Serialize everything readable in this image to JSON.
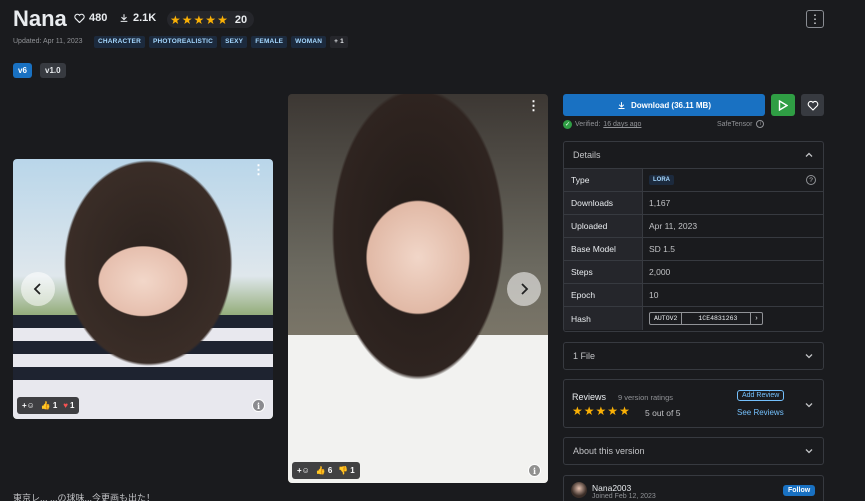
{
  "header": {
    "title": "Nana",
    "likes": "480",
    "downloads": "2.1K",
    "rating_count": "20",
    "updated": "Updated: Apr 11, 2023",
    "tags": [
      "CHARACTER",
      "PHOTOREALISTIC",
      "SEXY",
      "FEMALE",
      "WOMAN"
    ],
    "more_tags": "+ 1"
  },
  "versions": [
    "v6",
    "v1.0"
  ],
  "gallery": {
    "image1": {
      "thumbs_up": "1",
      "hearts": "1"
    },
    "image2": {
      "thumbs_up": "6",
      "thumbs_down": "1"
    }
  },
  "description_preview": "東京レ...  ...の球味...今更画も出た！",
  "sidebar": {
    "download_label": "Download (36.11 MB)",
    "verified_label": "Verified:",
    "verified_when": "16 days ago",
    "safetensor": "SafeTensor",
    "details_title": "Details",
    "details": [
      {
        "label": "Type",
        "value": "LORA"
      },
      {
        "label": "Downloads",
        "value": "1,167"
      },
      {
        "label": "Uploaded",
        "value": "Apr 11, 2023"
      },
      {
        "label": "Base Model",
        "value": "SD 1.5"
      },
      {
        "label": "Steps",
        "value": "2,000"
      },
      {
        "label": "Epoch",
        "value": "10"
      },
      {
        "label": "Hash",
        "value": ""
      }
    ],
    "hash_algo": "AUTOV2",
    "hash_value": "1CE4831263",
    "files_label": "1 File",
    "reviews_label": "Reviews",
    "version_ratings": "9 version ratings",
    "rating_text": "5 out of 5",
    "add_review": "Add Review",
    "see_reviews": "See Reviews",
    "about_label": "About this version",
    "creator_name": "Nana2003",
    "creator_joined": "Joined Feb 12, 2023",
    "follow_label": "Follow"
  },
  "colors": {
    "accent": "#1971c2",
    "success": "#2f9e44",
    "star": "#fab005",
    "background": "#1a1b1e"
  }
}
